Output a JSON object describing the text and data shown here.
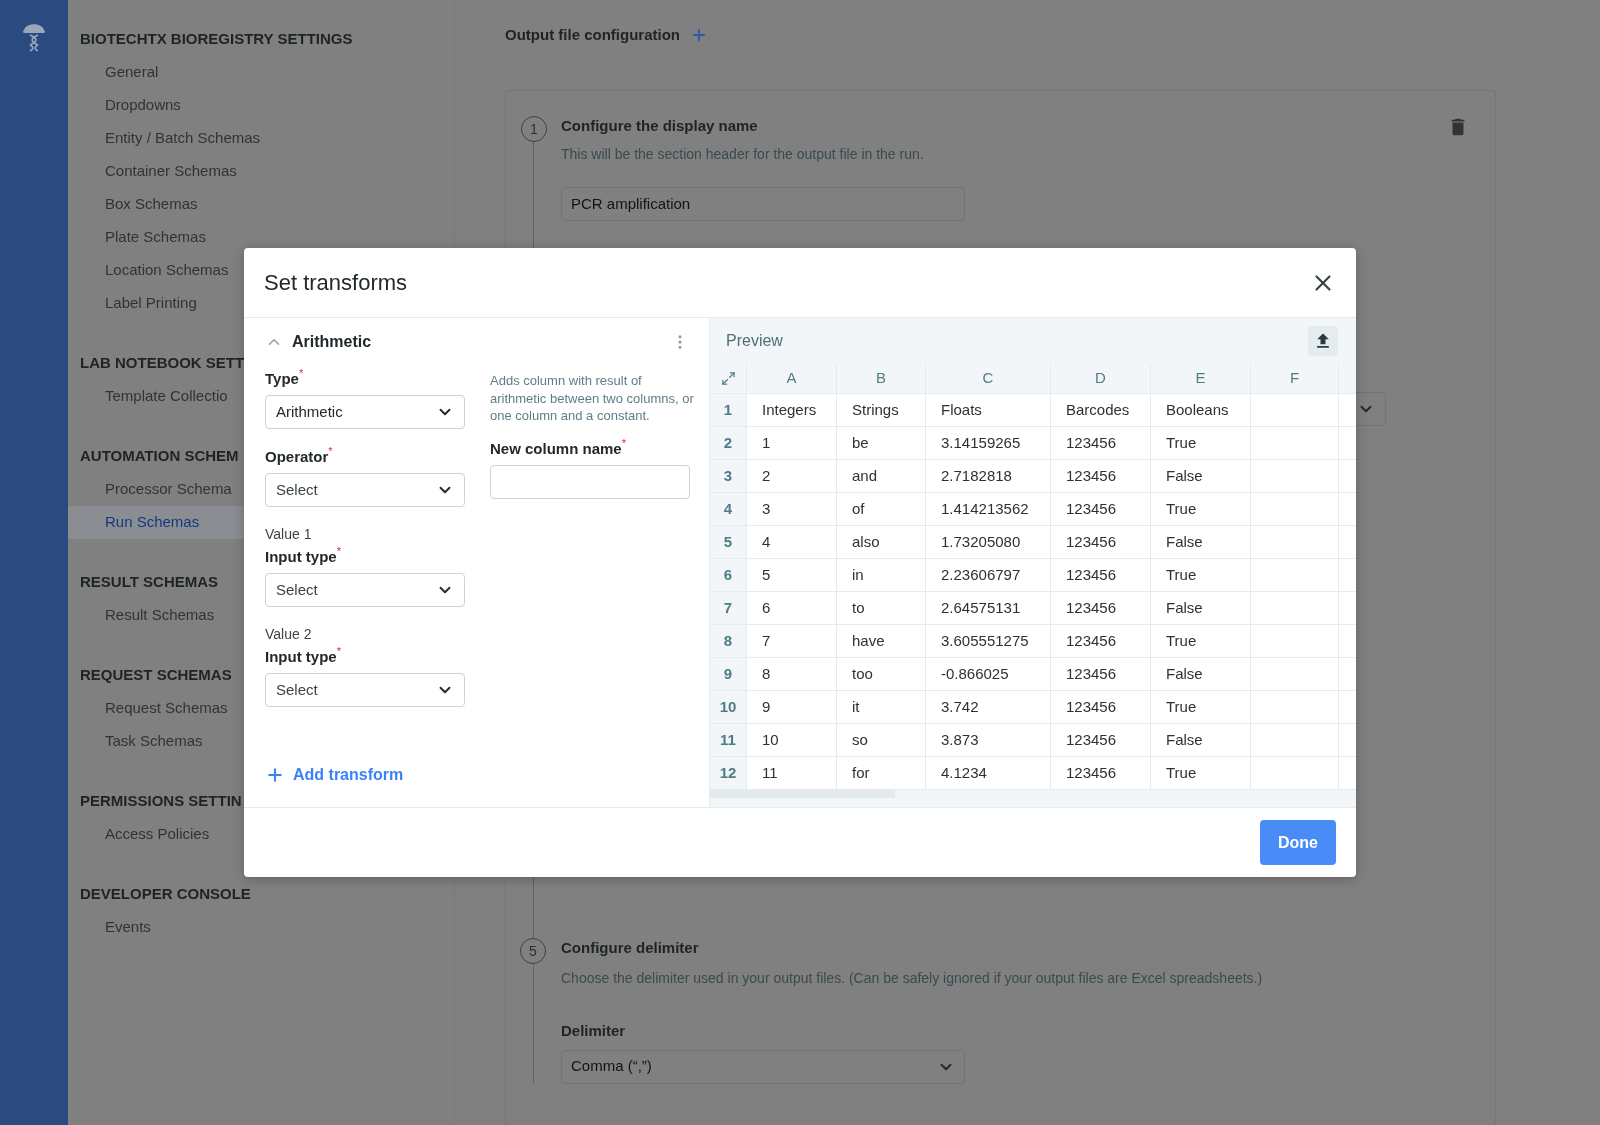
{
  "sidebar": {
    "sections": [
      {
        "title": "BIOTECHTX BIOREGISTRY SETTINGS",
        "items": [
          {
            "label": "General",
            "selected": false
          },
          {
            "label": "Dropdowns",
            "selected": false
          },
          {
            "label": "Entity / Batch Schemas",
            "selected": false
          },
          {
            "label": "Container Schemas",
            "selected": false
          },
          {
            "label": "Box Schemas",
            "selected": false
          },
          {
            "label": "Plate Schemas",
            "selected": false
          },
          {
            "label": "Location Schemas",
            "selected": false
          },
          {
            "label": "Label Printing",
            "selected": false
          }
        ]
      },
      {
        "title": "LAB NOTEBOOK SETT",
        "items": [
          {
            "label": "Template Collectio",
            "selected": false
          }
        ]
      },
      {
        "title": "AUTOMATION SCHEM",
        "items": [
          {
            "label": "Processor Schema",
            "selected": false
          },
          {
            "label": "Run Schemas",
            "selected": true
          }
        ]
      },
      {
        "title": "RESULT SCHEMAS",
        "items": [
          {
            "label": "Result Schemas",
            "selected": false
          }
        ]
      },
      {
        "title": "REQUEST SCHEMAS",
        "items": [
          {
            "label": "Request Schemas",
            "selected": false
          },
          {
            "label": "Task Schemas",
            "selected": false
          }
        ]
      },
      {
        "title": "PERMISSIONS SETTIN",
        "items": [
          {
            "label": "Access Policies",
            "selected": false
          }
        ]
      },
      {
        "title": "DEVELOPER CONSOLE",
        "items": [
          {
            "label": "Events",
            "selected": false
          }
        ]
      }
    ]
  },
  "main": {
    "title": "Output file configuration",
    "step_1": {
      "number": "1",
      "title": "Configure the display name",
      "description": "This will be the section header for the output file in the run.",
      "value": "PCR amplification"
    },
    "step_5": {
      "number": "5",
      "title": "Configure delimiter",
      "description": "Choose the delimiter used in your output files. (Can be safely ignored if your output files are Excel spreadsheets.)",
      "label": "Delimiter",
      "value": "Comma (“,”)"
    }
  },
  "modal": {
    "title": "Set transforms",
    "transform": {
      "title": "Arithmetic",
      "expanded": true,
      "description": "Adds column with result of arithmetic between two columns, or one column and a constant.",
      "left_fields": [
        {
          "kind": "select",
          "label": "Type",
          "mark": "*",
          "value": "Arithmetic"
        },
        {
          "kind": "select",
          "label": "Operator",
          "mark": "*",
          "placeholder": "Select"
        },
        {
          "kind": "select",
          "group": "Value 1",
          "label": "Input type",
          "mark": "*",
          "placeholder": "Select"
        },
        {
          "kind": "select",
          "group": "Value 2",
          "label": "Input type",
          "mark": "*",
          "placeholder": "Select"
        }
      ],
      "right_fields": [
        {
          "kind": "text",
          "label": "New column name",
          "mark": "*"
        }
      ]
    },
    "add_label": "Add transform",
    "preview": {
      "title": "Preview",
      "columns": [
        "A",
        "B",
        "C",
        "D",
        "E",
        "F"
      ],
      "rows": [
        {
          "number": "1",
          "cells": [
            "Integers",
            "Strings",
            "Floats",
            "Barcodes",
            "Booleans"
          ]
        },
        {
          "number": "2",
          "cells": [
            "1",
            "be",
            "3.14159265",
            "123456",
            "True"
          ]
        },
        {
          "number": "3",
          "cells": [
            "2",
            "and",
            "2.7182818",
            "123456",
            "False"
          ]
        },
        {
          "number": "4",
          "cells": [
            "3",
            "of",
            "1.414213562",
            "123456",
            "True"
          ]
        },
        {
          "number": "5",
          "cells": [
            "4",
            "also",
            "1.73205080",
            "123456",
            "False"
          ]
        },
        {
          "number": "6",
          "cells": [
            "5",
            "in",
            "2.23606797",
            "123456",
            "True"
          ]
        },
        {
          "number": "7",
          "cells": [
            "6",
            "to",
            "2.64575131",
            "123456",
            "False"
          ]
        },
        {
          "number": "8",
          "cells": [
            "7",
            "have",
            "3.605551275",
            "123456",
            "True"
          ]
        },
        {
          "number": "9",
          "cells": [
            "8",
            "too",
            "-0.866025",
            "123456",
            "False"
          ]
        },
        {
          "number": "10",
          "cells": [
            "9",
            "it",
            "3.742",
            "123456",
            "True"
          ]
        },
        {
          "number": "11",
          "cells": [
            "10",
            "so",
            "3.873",
            "123456",
            "False"
          ]
        },
        {
          "number": "12",
          "cells": [
            "11",
            "for",
            "4.1234",
            "123456",
            "True"
          ]
        }
      ]
    },
    "done_label": "Done"
  }
}
